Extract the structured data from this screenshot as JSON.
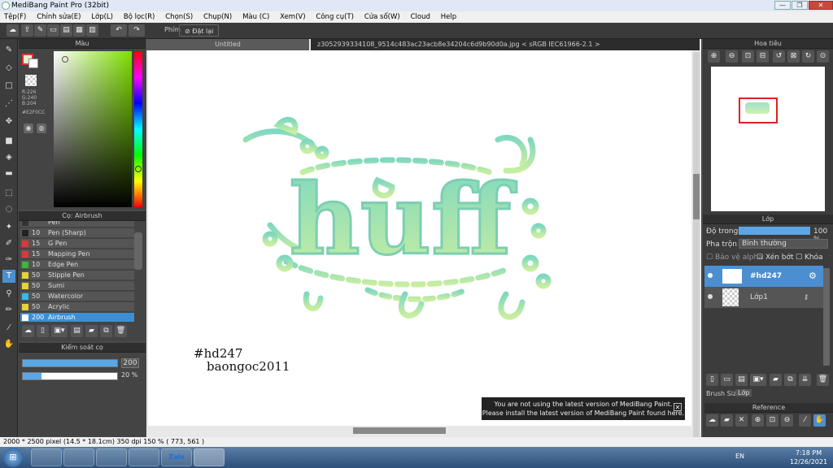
{
  "window": {
    "title": "MediBang Paint Pro (32bit)",
    "min_label": "—",
    "max_label": "❐",
    "close_label": "✕"
  },
  "menu": [
    "Tệp(F)",
    "Chỉnh sửa(E)",
    "Lớp(L)",
    "Bộ lọc(R)",
    "Chọn(S)",
    "Chụp(N)",
    "Màu (C)",
    "Xem(V)",
    "Công cụ(T)",
    "Cửa sổ(W)",
    "Cloud",
    "Help"
  ],
  "toolbar": {
    "shortcut_label": "Phím",
    "reset_label": "Đặt lại"
  },
  "color_panel": {
    "title": "Màu",
    "r": "R:226",
    "g": "G:240",
    "b": "B:204",
    "hex": "#E2F0CC"
  },
  "brush_panel": {
    "title": "Cọ: Airbrush",
    "items": [
      {
        "size": "",
        "name": "Pen",
        "color": "#333333"
      },
      {
        "size": "10",
        "name": "Pen (Sharp)",
        "color": "#222222"
      },
      {
        "size": "15",
        "name": "G Pen",
        "color": "#d83a3a"
      },
      {
        "size": "15",
        "name": "Mapping Pen",
        "color": "#d83a3a"
      },
      {
        "size": "10",
        "name": "Edge Pen",
        "color": "#3ab83a"
      },
      {
        "size": "50",
        "name": "Stipple Pen",
        "color": "#e6d23a"
      },
      {
        "size": "50",
        "name": "Sumi",
        "color": "#e6d23a"
      },
      {
        "size": "50",
        "name": "Watercolor",
        "color": "#3ab8e6"
      },
      {
        "size": "50",
        "name": "Acrylic",
        "color": "#e6d23a"
      },
      {
        "size": "200",
        "name": "Airbrush",
        "color": "#ffffff"
      }
    ]
  },
  "brush_control": {
    "title": "Kiểm soát cọ",
    "size_value": "200",
    "opacity_value": "20 %",
    "size_fraction": 1.0,
    "opacity_fraction": 0.2
  },
  "tabs": {
    "untitled": "Untitled",
    "file": "z3052939334108_9514c483ac23acb8e34204c6d9b90d0a.jpg < sRGB IEC61966-2.1 >"
  },
  "canvas": {
    "word": "huff",
    "hashtag": "#hd247",
    "author": "baongoc2011"
  },
  "navigator": {
    "title": "Hoa tiêu"
  },
  "layers": {
    "title": "Lớp",
    "opacity_label": "Độ trong",
    "opacity_value": "100 %",
    "blend_label": "Pha trộn",
    "blend_value": "Bình thường",
    "protect_alpha": "Bảo vệ alpha",
    "clipping": "Xén bớt",
    "lock": "Khóa",
    "rows": [
      {
        "name": "#hd247"
      },
      {
        "name": "Lớp1"
      }
    ],
    "tab_brush_size": "Brush Size",
    "tab_layer": "Lớp"
  },
  "reference": {
    "title": "Reference"
  },
  "notice": {
    "line1": "You are not using the latest version of MediBang Paint.",
    "line2": "Please install the latest version of MediBang Paint found here."
  },
  "status": {
    "text": "2000 * 2500 pixel   (14.5 * 18.1cm)   350 dpi   150 %   ( 773, 561 )"
  },
  "taskbar": {
    "lang": "EN",
    "time": "7:18 PM",
    "date": "12/26/2021",
    "zalo_label": "Zalo"
  }
}
